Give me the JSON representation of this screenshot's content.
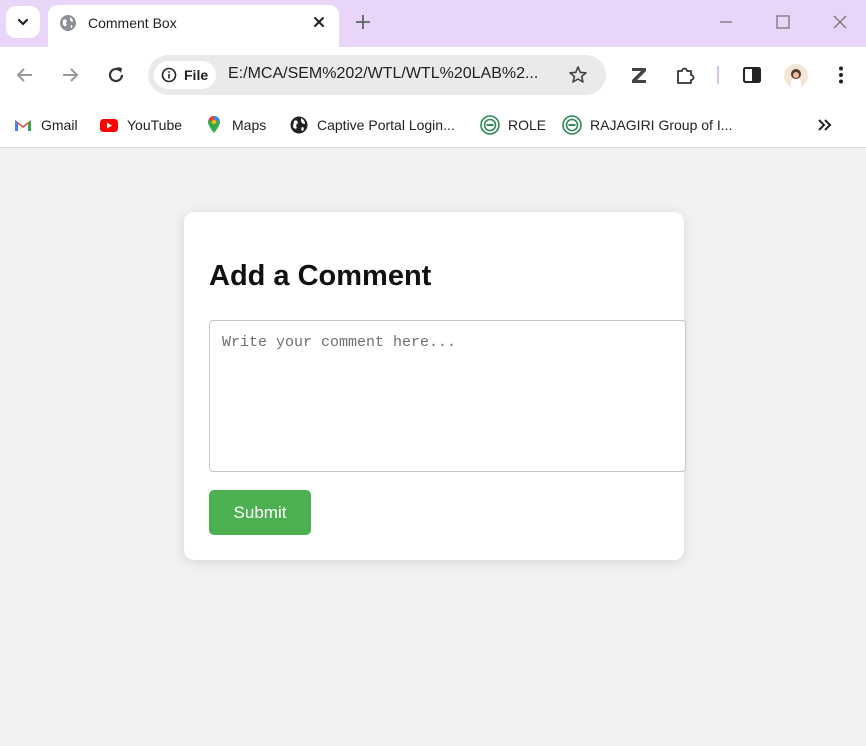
{
  "browser": {
    "tab": {
      "title": "Comment Box"
    },
    "address": {
      "scheme_chip": "File",
      "url": "E:/MCA/SEM%202/WTL/WTL%20LAB%2..."
    },
    "bookmarks": [
      {
        "label": "Gmail",
        "icon": "gmail-icon"
      },
      {
        "label": "YouTube",
        "icon": "youtube-icon"
      },
      {
        "label": "Maps",
        "icon": "maps-icon"
      },
      {
        "label": "Captive Portal Login...",
        "icon": "globe-icon"
      },
      {
        "label": "ROLE",
        "icon": "role-logo-icon"
      },
      {
        "label": "RAJAGIRI Group of I...",
        "icon": "rajagiri-logo-icon"
      }
    ],
    "colors": {
      "tabstrip": "#e9d5f7",
      "content_bg": "#f2f2f2",
      "accent_green": "#4caf50"
    }
  },
  "page": {
    "heading": "Add a Comment",
    "comment": {
      "placeholder": "Write your comment here...",
      "value": ""
    },
    "submit_label": "Submit"
  }
}
